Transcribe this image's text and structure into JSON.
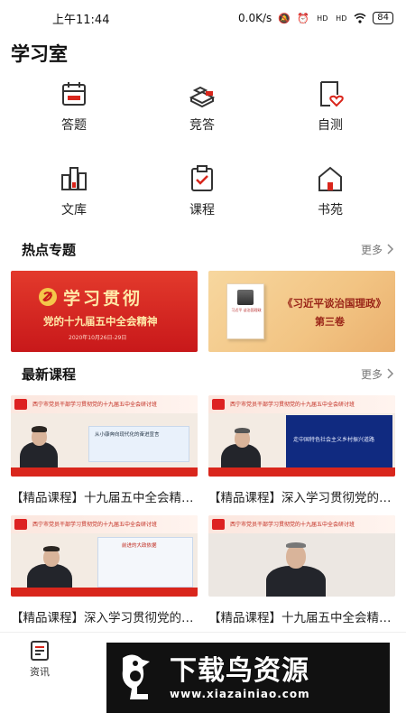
{
  "status_bar": {
    "time": "上午11:44",
    "network_speed": "0.0K/s",
    "battery": "84",
    "signal_1": "HD",
    "signal_2": "HD"
  },
  "page_title": "学习室",
  "grid": [
    {
      "label": "答题",
      "icon": "calendar-icon"
    },
    {
      "label": "竞答",
      "icon": "blocks-icon"
    },
    {
      "label": "自测",
      "icon": "heart-document-icon"
    },
    {
      "label": "文库",
      "icon": "bar-columns-icon"
    },
    {
      "label": "课程",
      "icon": "clipboard-icon"
    },
    {
      "label": "书苑",
      "icon": "house-icon"
    }
  ],
  "hot_topics": {
    "title": "热点专题",
    "more": "更多",
    "banners": [
      {
        "main": "学习贯彻",
        "sub": "党的十九届五中全会精神",
        "date": "2020年10月26日-29日"
      },
      {
        "main": "《习近平谈治国理政》",
        "sub": "第三卷",
        "book_text": "习近平 谈治国理政"
      }
    ]
  },
  "latest_courses": {
    "title": "最新课程",
    "more": "更多",
    "thumb_header": "西宁市党员干部学习贯彻党的十九届五中全会研讨班",
    "courses": [
      {
        "title": "【精品课程】十九届五中全会精神解读",
        "slide": "从小康奔向现代化的奋进宣言"
      },
      {
        "title": "【精品课程】深入学习贯彻党的十九届五中全会精神",
        "slide": "走中国特色社会主义乡村振兴道路"
      },
      {
        "title": "【精品课程】深入学习贯彻党的十九届五中全会精神",
        "slide": "前进的大政依据"
      },
      {
        "title": "【精品课程】十九届五中全会精神宣讲",
        "slide": ""
      }
    ]
  },
  "tabbar": {
    "items": [
      {
        "label": "资讯",
        "icon": "news-icon"
      }
    ]
  },
  "watermark": {
    "main": "下载鸟资源",
    "url": "www.xiazainiao.com"
  },
  "colors": {
    "accent_red": "#d9261c",
    "gold": "#f2c483",
    "text": "#222222"
  }
}
